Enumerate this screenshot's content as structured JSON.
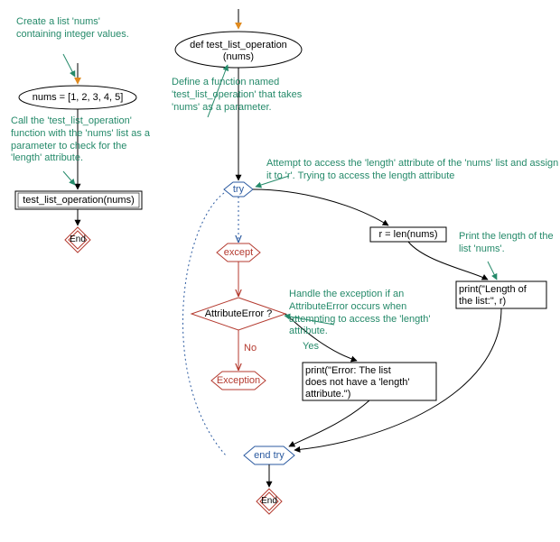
{
  "left": {
    "annotation_create": "Create a list 'nums'\ncontaining integer\nvalues.",
    "nums_code": "nums = [1, 2, 3, 4, 5]",
    "annotation_call": "Call the 'test_list_operation'\nfunction with the 'nums'\nlist as a parameter to\ncheck for the 'length'\nattribute.",
    "call_code": "test_list_operation(nums)",
    "end": "End"
  },
  "right": {
    "func_def": "def test_list_operation\n(nums)",
    "annotation_def": "Define a function named\n'test_list_operation' that\ntakes 'nums' as a\nparameter.",
    "try_label": "try",
    "annotation_try": "Attempt to access the 'length' attribute of the 'nums' list and\nassign it to 'r'.\nTrying to access the length attribute",
    "r_len": "r = len(nums)",
    "annotation_printlen": "Print the length\nof the list 'nums'.",
    "print_len": "print(\"Length of\nthe list:\", r)",
    "except_label": "except",
    "attr_q": "AttributeError ?",
    "annotation_attr": "Handle the exception if\nan AttributeError occurs\nwhen attempting to access\nthe 'length' attribute.",
    "exception_label": "Exception",
    "yes": "Yes",
    "no": "No",
    "print_err": "print(\"Error: The list\ndoes not have a 'length'\nattribute.\")",
    "end_try": "end try",
    "end": "End"
  }
}
